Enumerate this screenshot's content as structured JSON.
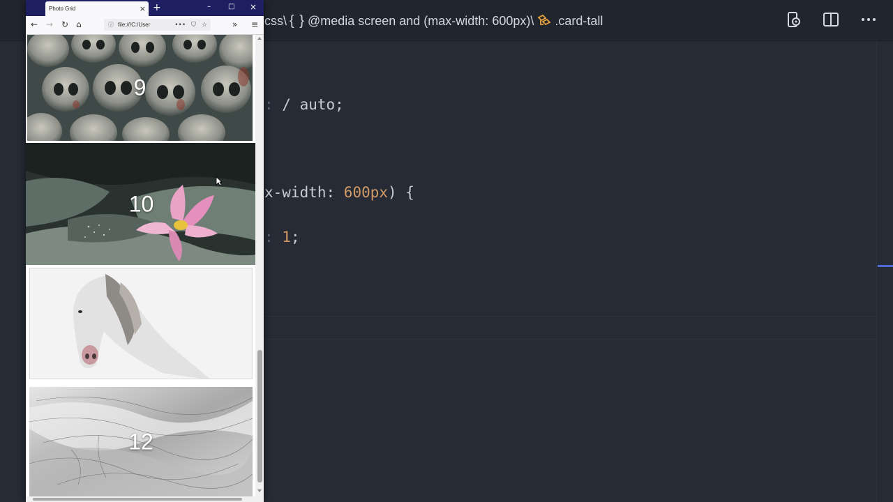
{
  "editor": {
    "breadcrumb": {
      "partial_file": "css\\",
      "braces_icon": "{ }",
      "media": "@media screen and (max-width: 600px)\\",
      "selector": ".card-tall"
    },
    "code": {
      "line1": "/ auto;",
      "line2_prop": "x-width: ",
      "line2_val": "600px",
      "line2_end": ") {",
      "line3_val": "1",
      "line3_end": ";"
    },
    "accent_color": "#4f6bd6",
    "number_color": "#d19a66"
  },
  "browser": {
    "tab_title": "Photo Grid",
    "tab_close": "×",
    "new_tab": "+",
    "window_controls": {
      "minimize": "–",
      "maximize": "□",
      "close": "×"
    },
    "nav": {
      "back": "←",
      "forward": "→",
      "reload": "↻",
      "home": "⌂"
    },
    "url": "file:///C:/User",
    "url_info_icon": "ⓘ",
    "url_actions": {
      "more": "•••",
      "pocket": "⛉",
      "bookmark": "☆"
    },
    "overflow": "»",
    "menu": "≡",
    "photos": [
      {
        "label": "9",
        "theme": "skulls"
      },
      {
        "label": "10",
        "theme": "lotus"
      },
      {
        "label": "",
        "theme": "white-horse"
      },
      {
        "label": "12",
        "theme": "silver-dunes"
      }
    ]
  }
}
